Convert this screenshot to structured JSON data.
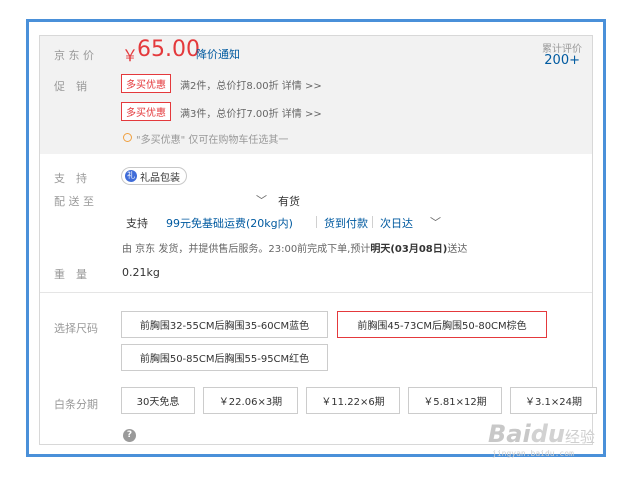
{
  "price": {
    "label": "京 东 价",
    "symbol": "￥",
    "value": "65.00",
    "notice_link": "降价通知"
  },
  "reviews": {
    "label": "累计评价",
    "count": "200+"
  },
  "promotion": {
    "label": "促　销",
    "items": [
      {
        "tag": "多买优惠",
        "text": "满2件，总价打8.00折 详情 >>"
      },
      {
        "tag": "多买优惠",
        "text": "满3件，总价打7.00折 详情 >>"
      }
    ],
    "hint": "\"多买优惠\" 仅可在购物车任选其一"
  },
  "support": {
    "label": "支　持",
    "gift_icon": "礼",
    "gift_text": "礼品包装"
  },
  "delivery": {
    "label": "配 送 至",
    "stock": "有货",
    "support_label": "支持",
    "free_shipping": "99元免基础运费(20kg内)",
    "cod": "货到付款",
    "next_day": "次日达",
    "note_prefix": "由 京东 发货，并提供售后服务。23:00前完成下单,预计",
    "note_date": "明天(03月08日)",
    "note_suffix": "送达"
  },
  "weight": {
    "label": "重　量",
    "value": "0.21kg"
  },
  "size": {
    "label": "选择尺码",
    "options": [
      "前胸围32-55CM后胸围35-60CM蓝色",
      "前胸围45-73CM后胸围50-80CM棕色",
      "前胸围50-85CM后胸围55-95CM红色"
    ],
    "selected_index": 1
  },
  "installment": {
    "label": "白条分期",
    "options": [
      "30天免息",
      "￥22.06×3期",
      "￥11.22×6期",
      "￥5.81×12期",
      "￥3.1×24期"
    ],
    "help_icon": "?"
  },
  "watermark": {
    "main": "Bai",
    "paw": "du",
    "sub": "经验",
    "url": "jingyan.baidu.com"
  },
  "colors": {
    "accent_red": "#e4393c",
    "link_blue": "#005aa0",
    "frame_blue": "#4a90d9"
  }
}
